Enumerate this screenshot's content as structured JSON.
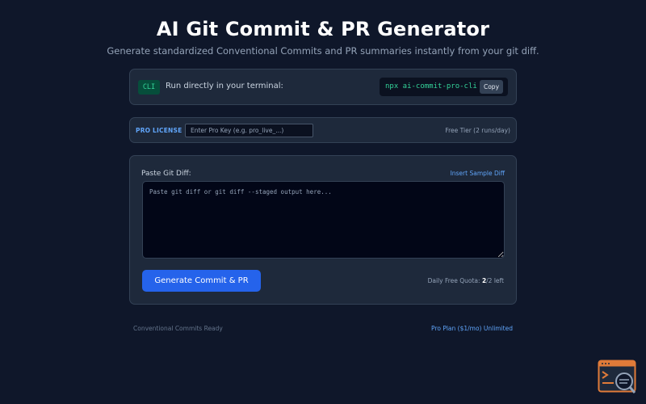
{
  "header": {
    "title": "AI Git Commit & PR Generator",
    "subtitle": "Generate standardized Conventional Commits and PR summaries instantly from your git diff."
  },
  "cli": {
    "badge": "CLI",
    "text": "Run directly in your terminal:",
    "command": "npx ai-commit-pro-cli",
    "copy_label": "Copy"
  },
  "license": {
    "label": "PRO LICENSE",
    "placeholder": "Enter Pro Key (e.g. pro_live_...)",
    "tier": "Free Tier (2 runs/day)"
  },
  "diff": {
    "label": "Paste Git Diff:",
    "sample_link": "Insert Sample Diff",
    "placeholder": "Paste git diff or git diff --staged output here..."
  },
  "actions": {
    "generate_label": "Generate Commit & PR",
    "quota_prefix": "Daily Free Quota: ",
    "quota_used": "2",
    "quota_suffix": "/2 left"
  },
  "footer": {
    "left": "Conventional Commits Ready",
    "right": "Pro Plan ($1/mo) Unlimited"
  },
  "colors": {
    "background": "#0f172a",
    "card": "#1e293b",
    "accent_blue": "#2563eb",
    "link_blue": "#60a5fa",
    "command_green": "#34d399",
    "corner_icon_orange": "#e07b39"
  },
  "icons": {
    "corner": "terminal-window-magnifier-icon"
  }
}
